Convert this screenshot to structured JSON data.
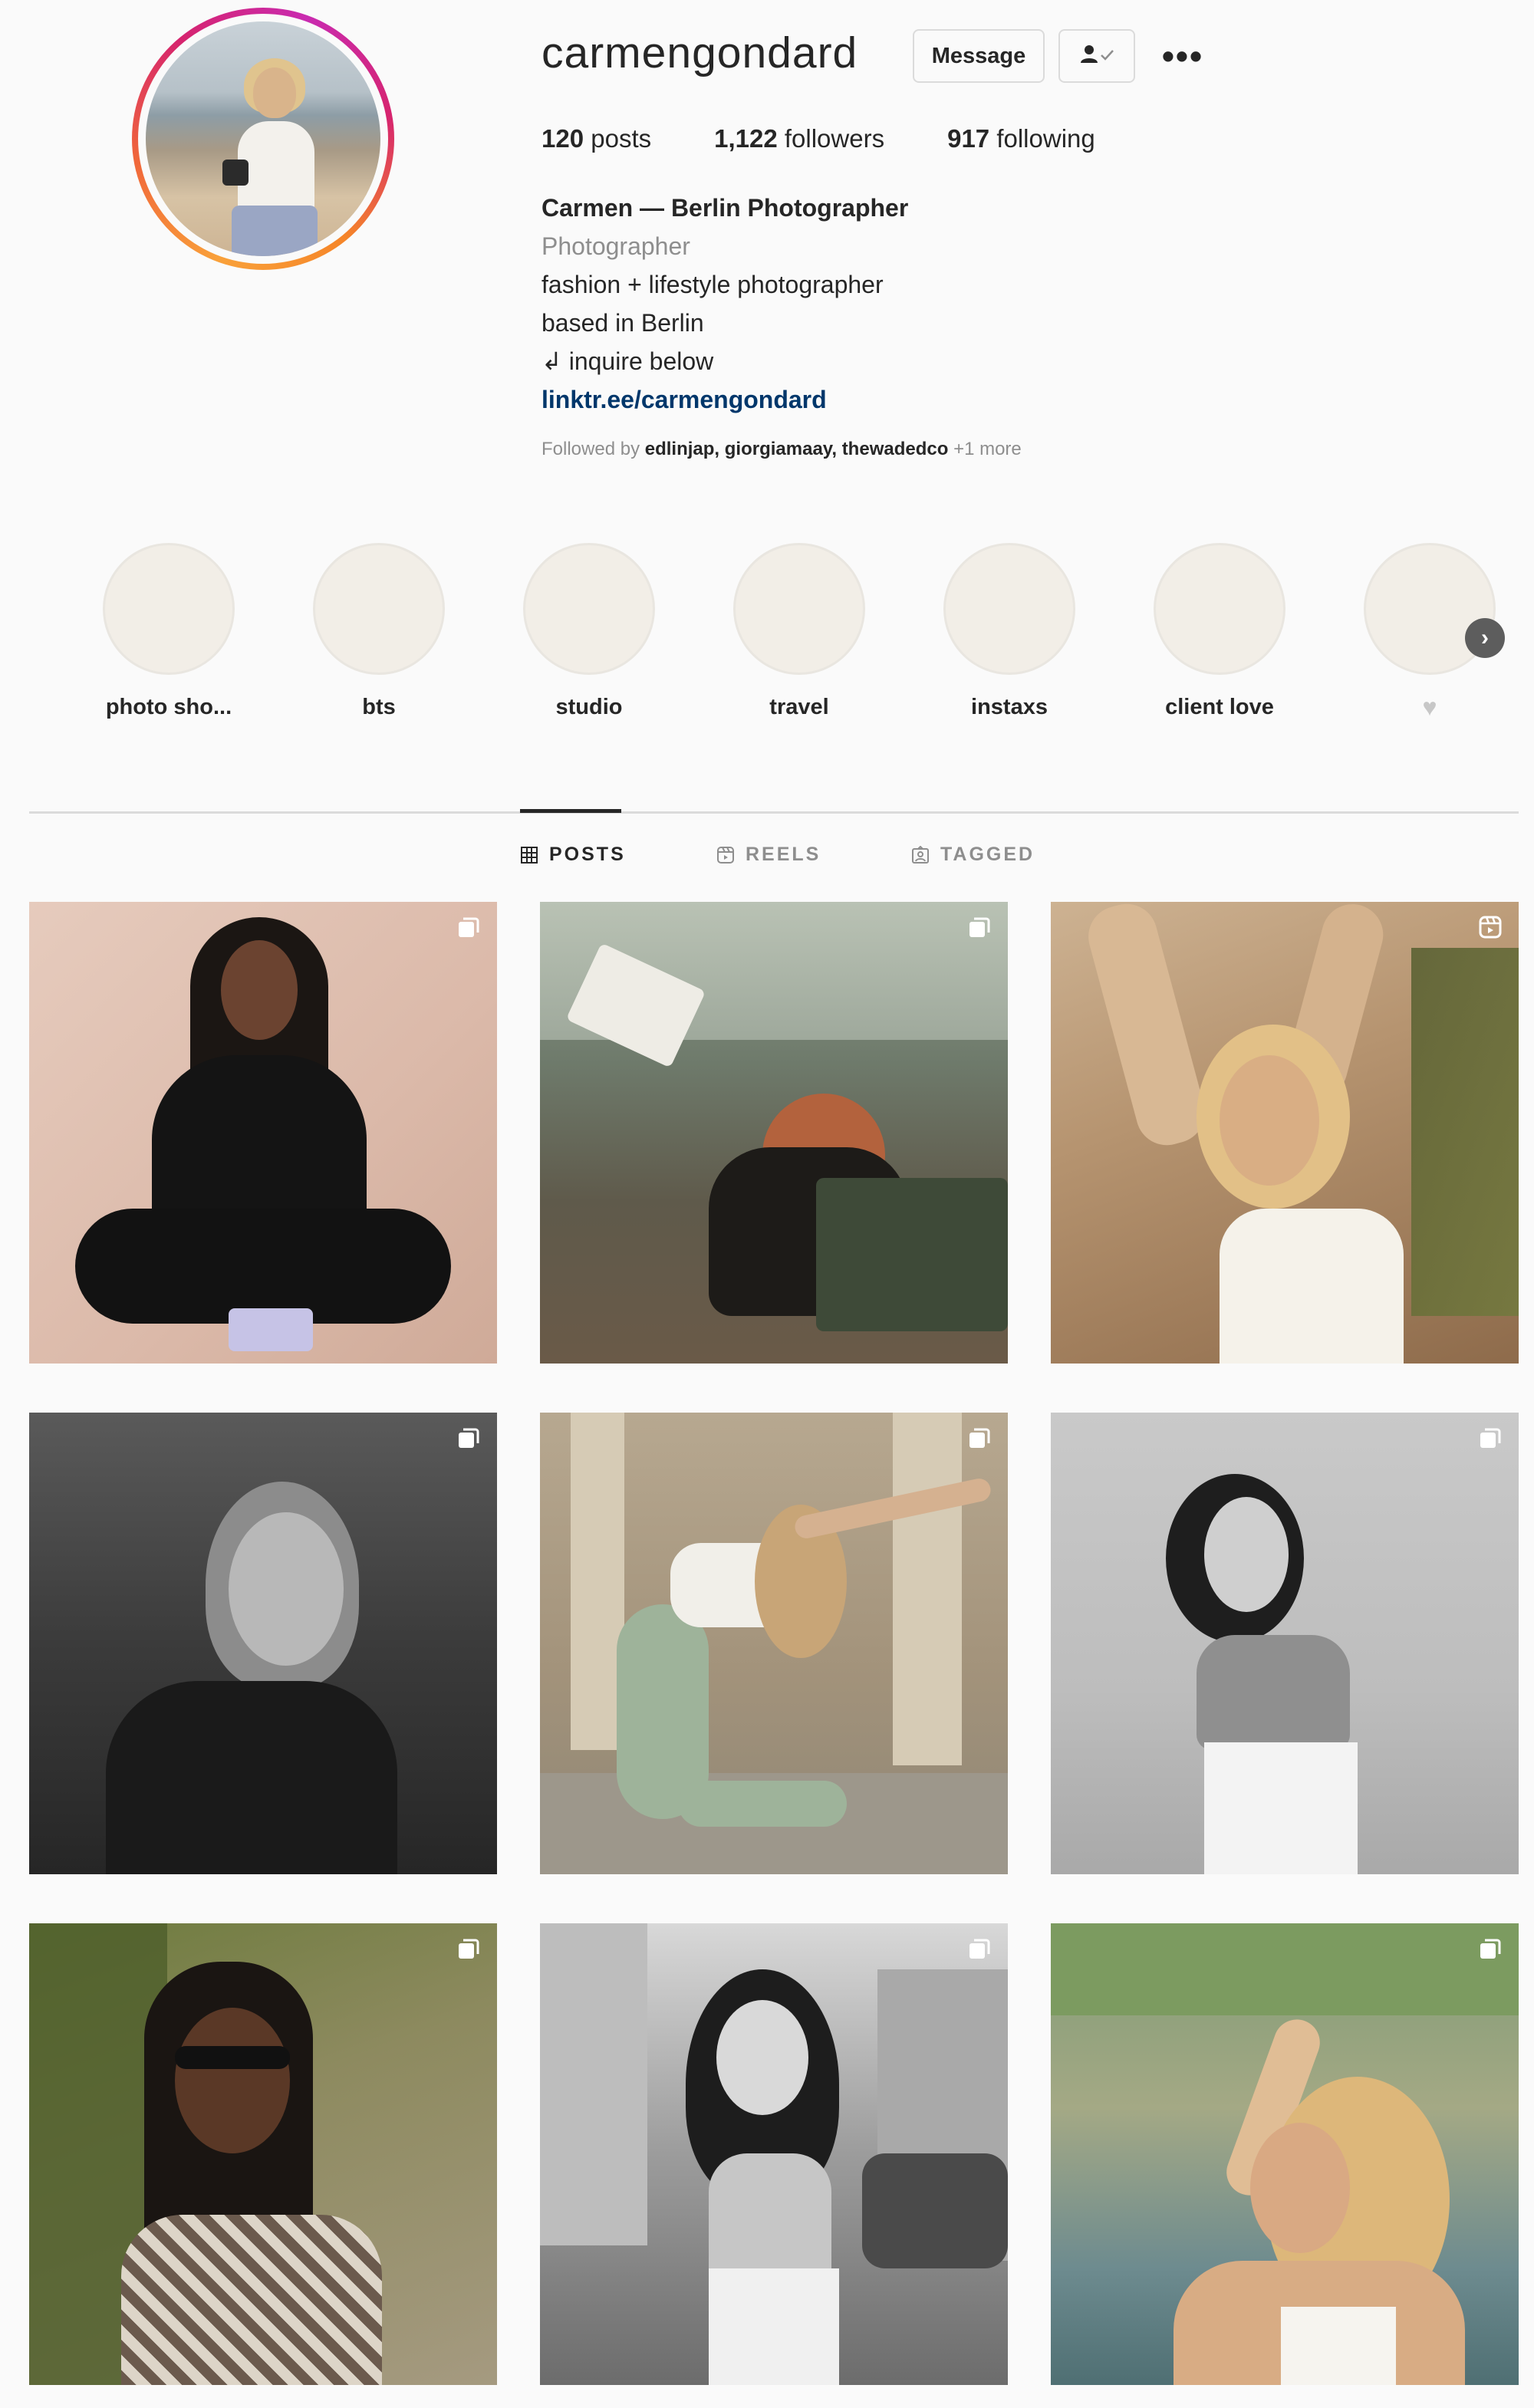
{
  "profile": {
    "username": "carmengondard",
    "message_label": "Message",
    "more_label": "•••"
  },
  "stats": {
    "posts_count": "120",
    "posts_label": "posts",
    "followers_count": "1,122",
    "followers_label": "followers",
    "following_count": "917",
    "following_label": "following"
  },
  "bio": {
    "name": "Carmen — Berlin Photographer",
    "category": "Photographer",
    "line1": "fashion + lifestyle photographer",
    "line2": "based in Berlin",
    "line3": "↲ inquire below",
    "link": "linktr.ee/carmengondard"
  },
  "followed_by": {
    "prefix": "Followed by",
    "users": "edlinjap, giorgiamaay, thewadedco",
    "more": "+1 more"
  },
  "highlights": [
    {
      "label": "photo sho..."
    },
    {
      "label": "bts"
    },
    {
      "label": "studio"
    },
    {
      "label": "travel"
    },
    {
      "label": "instaxs"
    },
    {
      "label": "client love"
    },
    {
      "label": "♥"
    }
  ],
  "tabs": {
    "posts": "POSTS",
    "reels": "REELS",
    "tagged": "TAGGED"
  },
  "posts": [
    {
      "type": "carousel",
      "icon": "carousel-icon"
    },
    {
      "type": "carousel",
      "icon": "carousel-icon"
    },
    {
      "type": "reel",
      "icon": "reel-icon"
    },
    {
      "type": "carousel",
      "icon": "carousel-icon"
    },
    {
      "type": "carousel",
      "icon": "carousel-icon"
    },
    {
      "type": "carousel",
      "icon": "carousel-icon"
    },
    {
      "type": "carousel",
      "icon": "carousel-icon"
    },
    {
      "type": "carousel",
      "icon": "carousel-icon"
    },
    {
      "type": "carousel",
      "icon": "carousel-icon"
    }
  ],
  "colors": {
    "background": "#fafafa",
    "text": "#262626",
    "muted": "#8e8e8e",
    "link": "#00376b"
  }
}
